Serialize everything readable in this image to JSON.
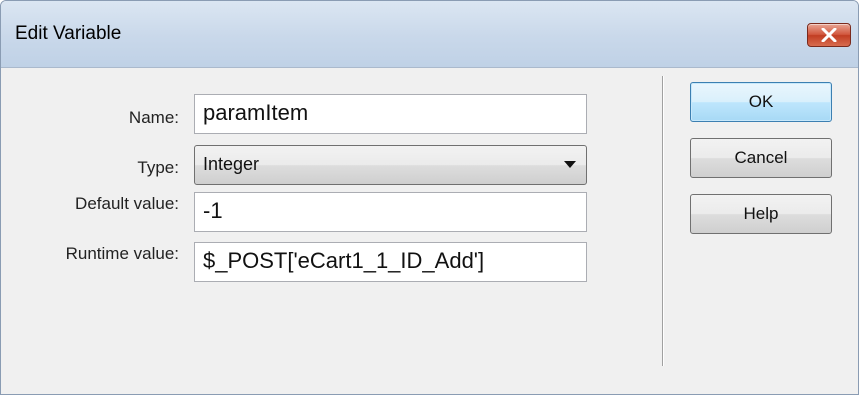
{
  "window": {
    "title": "Edit Variable"
  },
  "icons": {
    "close": "close-x-icon",
    "dropdown": "chevron-down-icon"
  },
  "form": {
    "name": {
      "label": "Name:",
      "value": "paramItem"
    },
    "type": {
      "label": "Type:",
      "value": "Integer",
      "options": [
        "Integer"
      ]
    },
    "default_value": {
      "label": "Default value:",
      "value": "-1"
    },
    "runtime_value": {
      "label": "Runtime value:",
      "value": "$_POST['eCart1_1_ID_Add']"
    }
  },
  "buttons": {
    "ok": "OK",
    "cancel": "Cancel",
    "help": "Help"
  },
  "colors": {
    "close_button": "#c94a2f",
    "default_button_border": "#3c7fb1",
    "titlebar": "#c9d8ea"
  }
}
